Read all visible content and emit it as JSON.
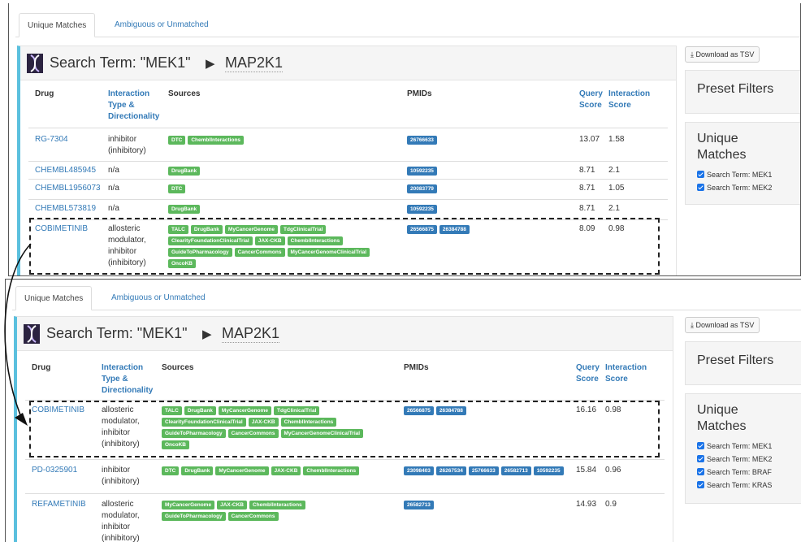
{
  "tabs": {
    "unique": "Unique Matches",
    "ambiguous": "Ambiguous or Unmatched"
  },
  "download_label": "Download as TSV",
  "table_headers": {
    "drug": "Drug",
    "interaction_type": [
      "Interaction",
      "Type &",
      "Directionality"
    ],
    "sources": "Sources",
    "pmids": "PMIDs",
    "query_score": [
      "Query",
      "Score"
    ],
    "interaction_score": [
      "Interaction",
      "Score"
    ]
  },
  "top": {
    "search_term": "Search Term: \"MEK1\"",
    "gene": "MAP2K1",
    "preset_filters": "Preset Filters",
    "unique_matches": [
      "Unique",
      "Matches"
    ],
    "filters": [
      "Search Term: MEK1",
      "Search Term: MEK2"
    ],
    "rows": [
      {
        "drug": "RG-7304",
        "itype": [
          "inhibitor",
          "(inhibitory)"
        ],
        "sources": [
          "DTC",
          "ChemblInteractions"
        ],
        "pmids": [
          "26766633"
        ],
        "query_score": "13.07",
        "interaction_score": "1.58"
      },
      {
        "drug": "CHEMBL485945",
        "itype": [
          "n/a"
        ],
        "sources": [
          "DrugBank"
        ],
        "pmids": [
          "10592235"
        ],
        "query_score": "8.71",
        "interaction_score": "2.1"
      },
      {
        "drug": "CHEMBL1956073",
        "itype": [
          "n/a"
        ],
        "sources": [
          "DTC"
        ],
        "pmids": [
          "20083779"
        ],
        "query_score": "8.71",
        "interaction_score": "1.05"
      },
      {
        "drug": "CHEMBL573819",
        "itype": [
          "n/a"
        ],
        "sources": [
          "DrugBank"
        ],
        "pmids": [
          "10592235"
        ],
        "query_score": "8.71",
        "interaction_score": "2.1"
      },
      {
        "drug": "COBIMETINIB",
        "itype": [
          "allosteric",
          "modulator,",
          "inhibitor",
          "(inhibitory)"
        ],
        "sources": [
          "TALC",
          "DrugBank",
          "MyCancerGenome",
          "TdgClinicalTrial",
          "ClearityFoundationClinicalTrial",
          "JAX-CKB",
          "ChemblInteractions",
          "GuideToPharmacology",
          "CancerCommons",
          "MyCancerGenomeClinicalTrial",
          "OncoKB"
        ],
        "pmids": [
          "26566875",
          "26384788"
        ],
        "query_score": "8.09",
        "interaction_score": "0.98"
      }
    ]
  },
  "bottom": {
    "search_term": "Search Term: \"MEK1\"",
    "gene": "MAP2K1",
    "preset_filters": "Preset Filters",
    "unique_matches": [
      "Unique",
      "Matches"
    ],
    "filters": [
      "Search Term: MEK1",
      "Search Term: MEK2",
      "Search Term: BRAF",
      "Search Term: KRAS"
    ],
    "rows": [
      {
        "drug": "COBIMETINIB",
        "itype": [
          "allosteric",
          "modulator,",
          "inhibitor",
          "(inhibitory)"
        ],
        "sources": [
          "TALC",
          "DrugBank",
          "MyCancerGenome",
          "TdgClinicalTrial",
          "ClearityFoundationClinicalTrial",
          "JAX-CKB",
          "ChemblInteractions",
          "GuideToPharmacology",
          "CancerCommons",
          "MyCancerGenomeClinicalTrial",
          "OncoKB"
        ],
        "pmids": [
          "26566875",
          "26384788"
        ],
        "query_score": "16.16",
        "interaction_score": "0.98"
      },
      {
        "drug": "PD-0325901",
        "itype": [
          "inhibitor",
          "(inhibitory)"
        ],
        "sources": [
          "DTC",
          "DrugBank",
          "MyCancerGenome",
          "JAX-CKB",
          "ChemblInteractions"
        ],
        "pmids": [
          "23098403",
          "26267534",
          "25766633",
          "26582713",
          "10592235"
        ],
        "query_score": "15.84",
        "interaction_score": "0.96"
      },
      {
        "drug": "REFAMETINIB",
        "itype": [
          "allosteric",
          "modulator,",
          "inhibitor",
          "(inhibitory)"
        ],
        "sources": [
          "MyCancerGenome",
          "JAX-CKB",
          "ChemblInteractions",
          "GuideToPharmacology",
          "CancerCommons"
        ],
        "pmids": [
          "26582713"
        ],
        "query_score": "14.93",
        "interaction_score": "0.9"
      }
    ]
  },
  "colors": {
    "accent": "#5bc0de",
    "link": "#337ab7",
    "source_badge": "#5cb85c",
    "pmid_badge": "#337ab7"
  }
}
